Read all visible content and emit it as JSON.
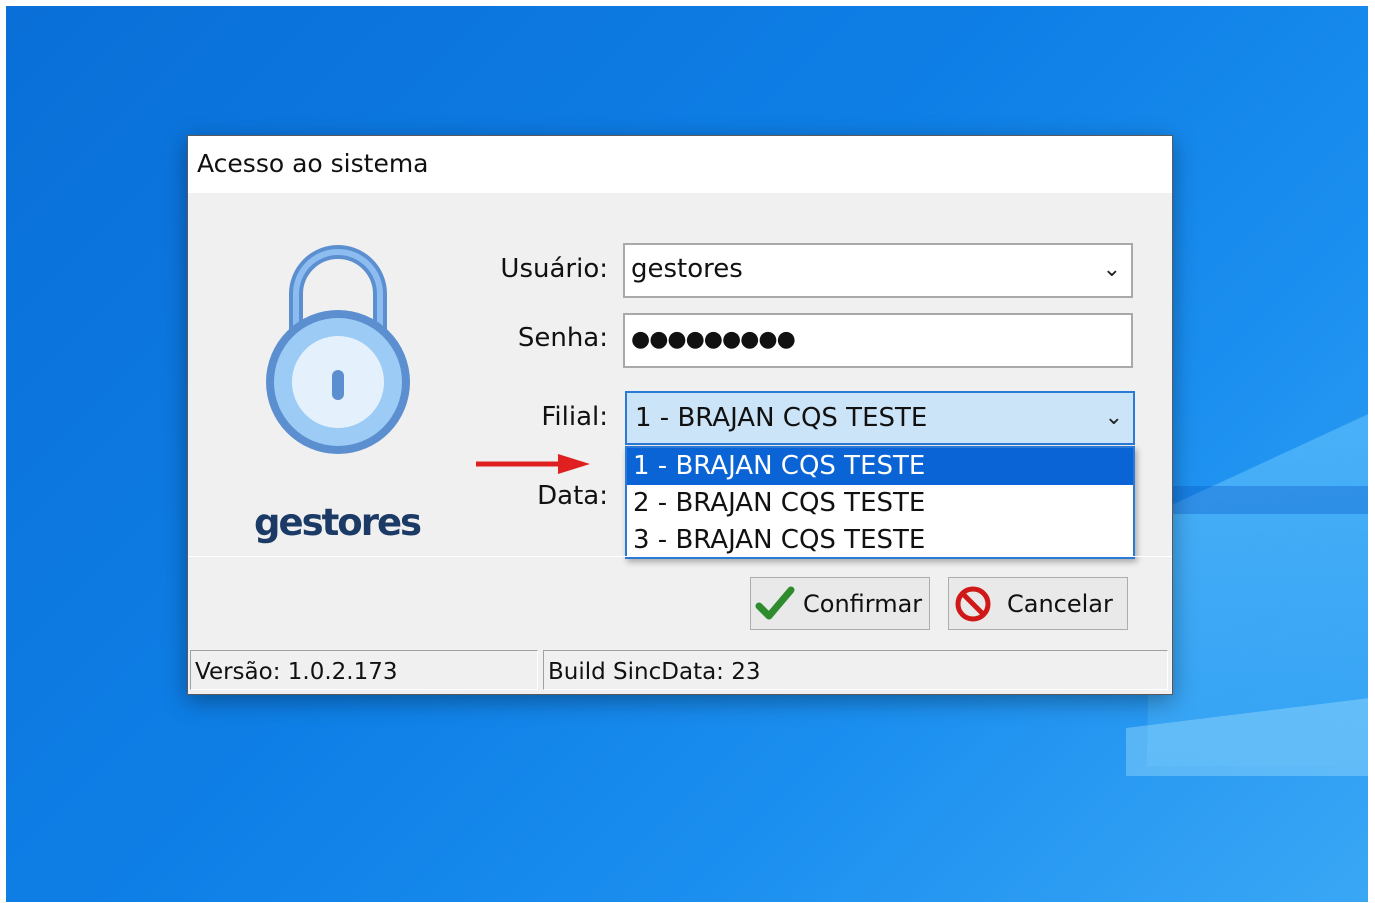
{
  "window": {
    "title": "Acesso ao sistema"
  },
  "logo": {
    "brand_text": "gestores"
  },
  "form": {
    "usuario_label": "Usuário:",
    "usuario_value": "gestores",
    "senha_label": "Senha:",
    "senha_value": "●●●●●●●●●",
    "filial_label": "Filial:",
    "filial_value": "1 - BRAJAN CQS TESTE",
    "data_label": "Data:"
  },
  "filial_options": [
    "1 - BRAJAN CQS TESTE",
    "2 - BRAJAN CQS TESTE",
    "3 - BRAJAN CQS TESTE"
  ],
  "buttons": {
    "confirm_label": "Confirmar",
    "cancel_label": "Cancelar"
  },
  "statusbar": {
    "version": "Versão: 1.0.2.173",
    "build": "Build SincData: 23"
  },
  "colors": {
    "selection": "#0a64d6",
    "combo_focus": "#cce4f7",
    "brand": "#1b3b66",
    "arrow": "#e02020",
    "check": "#2e8b2e",
    "cancel_icon": "#d01818"
  }
}
